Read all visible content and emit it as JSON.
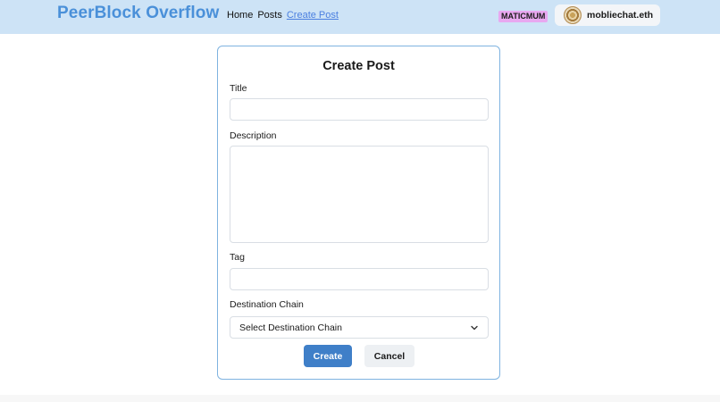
{
  "brand": "PeerBlock Overflow",
  "nav": [
    {
      "label": "Home",
      "active": false
    },
    {
      "label": "Posts",
      "active": false
    },
    {
      "label": "Create Post",
      "active": true
    }
  ],
  "chain_badge": "MATICMUM",
  "account": {
    "name": "mobliechat.eth",
    "avatar_icon": "avatar-icon"
  },
  "form": {
    "title": "Create Post",
    "title_label": "Title",
    "title_value": "",
    "description_label": "Description",
    "description_value": "",
    "tag_label": "Tag",
    "tag_value": "",
    "chain_label": "Destination Chain",
    "chain_selected": "Select Destination Chain",
    "create_label": "Create",
    "cancel_label": "Cancel"
  },
  "colors": {
    "navbar_bg": "#cde3f6",
    "brand": "#4a90d9",
    "primary_button": "#3f7fc8",
    "badge_bg": "#e8a8f0"
  }
}
